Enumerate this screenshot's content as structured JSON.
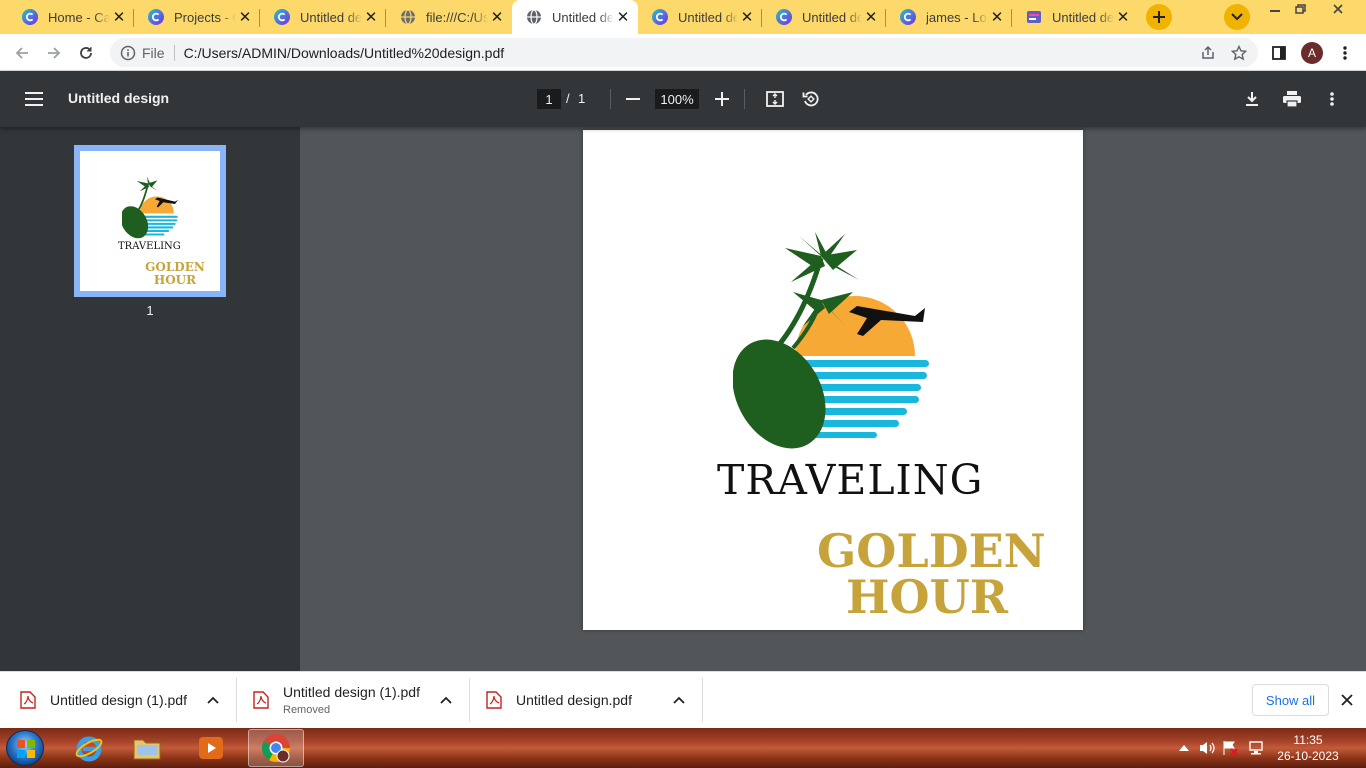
{
  "browser": {
    "tabs": [
      {
        "title": "Home - Canva",
        "favicon": "canva-icon",
        "active": false
      },
      {
        "title": "Projects - Canva",
        "favicon": "canva-icon",
        "active": false
      },
      {
        "title": "Untitled design",
        "favicon": "canva-icon",
        "active": false
      },
      {
        "title": "file:///C:/Users",
        "favicon": "globe-icon",
        "active": false
      },
      {
        "title": "Untitled design",
        "favicon": "globe-icon",
        "active": true
      },
      {
        "title": "Untitled design",
        "favicon": "canva-icon",
        "active": false
      },
      {
        "title": "Untitled design",
        "favicon": "canva-icon",
        "active": false
      },
      {
        "title": "james - Logo",
        "favicon": "canva-icon",
        "active": false
      },
      {
        "title": "Untitled design",
        "favicon": "pdf-app-icon",
        "active": false
      }
    ],
    "address": {
      "scheme_label": "File",
      "url": "C:/Users/ADMIN/Downloads/Untitled%20design.pdf"
    },
    "profile_initial": "A",
    "colors": {
      "tabstrip": "#fcd96a",
      "accent": "#f0b400"
    }
  },
  "pdf_viewer": {
    "title": "Untitled design",
    "current_page": "1",
    "page_separator": "/",
    "total_pages": "1",
    "zoom": "100%",
    "thumbnail_label": "1"
  },
  "document": {
    "logo_icon": "palm-tree-sun-airplane-logo",
    "heading": "TRAVELING",
    "brand_line1": "GOLDEN",
    "brand_line2": "HOUR",
    "colors": {
      "gold": "#c6a33b",
      "sun": "#f6a935",
      "sea": "#19b6de",
      "palm": "#1e5e1e"
    }
  },
  "downloads": {
    "items": [
      {
        "name": "Untitled design (1).pdf",
        "status": ""
      },
      {
        "name": "Untitled design (1).pdf",
        "status": "Removed"
      },
      {
        "name": "Untitled design.pdf",
        "status": ""
      }
    ],
    "show_all": "Show all"
  },
  "taskbar": {
    "apps": [
      "internet-explorer-icon",
      "file-explorer-icon",
      "media-player-icon",
      "chrome-icon"
    ],
    "time": "11:35",
    "date": "26-10-2023"
  }
}
